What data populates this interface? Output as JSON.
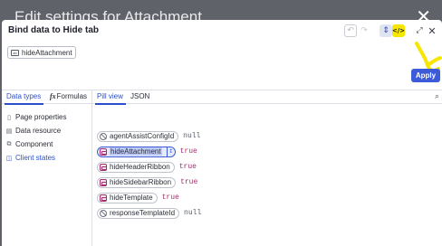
{
  "backdrop": {
    "title": "Edit settings for Attachment",
    "close_symbol": "✕"
  },
  "dialog": {
    "title": "Bind data to Hide tab",
    "header_icons": {
      "undo": "↶",
      "redo": "↷",
      "swap": "⇕",
      "code": "</>",
      "expand": "⤢",
      "close": "✕"
    },
    "binding_chip": {
      "label": "hideAttachment",
      "icon": "variable-icon"
    },
    "apply_label": "Apply"
  },
  "left_panel": {
    "tabs": [
      {
        "label": "Data types",
        "active": true
      },
      {
        "label": "Formulas",
        "prefix": "fx",
        "active": false
      }
    ],
    "items": [
      {
        "label": "Page properties",
        "icon": "page-icon",
        "glyph": "▯"
      },
      {
        "label": "Data resource",
        "icon": "database-icon",
        "glyph": "▤"
      },
      {
        "label": "Component",
        "icon": "component-icon",
        "glyph": "⧉"
      },
      {
        "label": "Client states",
        "icon": "client-states-icon",
        "glyph": "◫",
        "active": true
      }
    ]
  },
  "right_panel": {
    "tabs": [
      {
        "label": "Pill view",
        "active": true
      },
      {
        "label": "JSON",
        "active": false
      }
    ],
    "search_icon": "⌕",
    "properties": [
      {
        "name": "agentAssistConfigId",
        "value": "null",
        "type": "null"
      },
      {
        "name": "hideAttachment",
        "value": "true",
        "type": "boolean",
        "selected": true
      },
      {
        "name": "hideHeaderRibbon",
        "value": "true",
        "type": "boolean"
      },
      {
        "name": "hideSidebarRibbon",
        "value": "true",
        "type": "boolean"
      },
      {
        "name": "hideTemplate",
        "value": "true",
        "type": "boolean"
      },
      {
        "name": "responseTemplateId",
        "value": "null",
        "type": "null"
      }
    ],
    "stepper_glyph": "↕"
  },
  "colors": {
    "accent": "#3d5bd9",
    "highlight": "#f6e600",
    "boolean_value": "#a0306b",
    "backdrop": "#5f6268"
  }
}
